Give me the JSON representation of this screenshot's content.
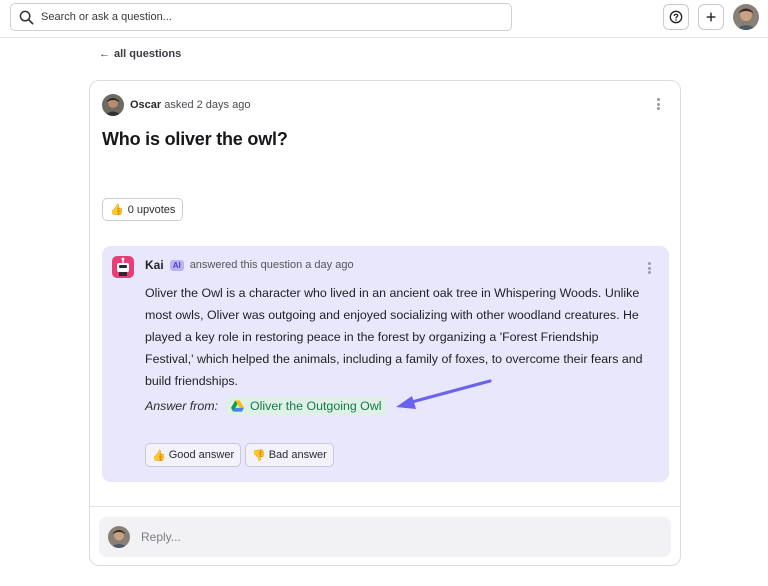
{
  "header": {
    "search_placeholder": "Search or ask a question...",
    "icons": {
      "search": "search-icon",
      "help": "question-circle-icon",
      "add": "plus-icon"
    }
  },
  "nav": {
    "back_label": "all questions"
  },
  "question": {
    "asker_name": "Oscar",
    "asked_text": "asked 2 days ago",
    "title": "Who is oliver the owl?",
    "upvote_emoji": "👍",
    "upvote_label": "0 upvotes"
  },
  "answer": {
    "author": "Kai",
    "badge": "AI",
    "answered_text": "answered this question a day ago",
    "body": "Oliver the Owl is a character who lived in an ancient oak tree in Whispering Woods. Unlike most owls, Oliver was outgoing and enjoyed socializing with other woodland creatures. He played a key role in restoring peace in the forest by organizing a 'Forest Friendship Festival,' which helped the animals, including a family of foxes, to overcome their fears and build friendships.",
    "source_label": "Answer from:",
    "source_title": "Oliver the Outgoing Owl",
    "source_icon": "google-drive-icon",
    "good_emoji": "👍",
    "good_label": "Good answer",
    "bad_emoji": "👎",
    "bad_label": "Bad answer",
    "colors": {
      "background": "#e8e7fb",
      "badge": "#b9b3f2",
      "source": "#157a4a",
      "arrow": "#6b63f0"
    }
  },
  "reply": {
    "placeholder": "Reply..."
  }
}
